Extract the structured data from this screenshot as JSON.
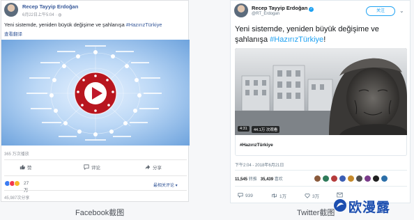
{
  "facebook": {
    "author": "Recep Tayyip Erdoğan",
    "timestamp": "6月22日上午5:04 · ",
    "post_text_prefix": "Yeni sistemde, yeniden büyük değişime ve şahlanışa ",
    "hashtag": "#HazırızTürkiye",
    "translate_label": "查看翻译",
    "views": "365 万次播放",
    "actions": {
      "like": "赞",
      "comment": "评论",
      "share": "分享"
    },
    "reactions_count": "27 万",
    "sort_label": "最相关评论 ▾",
    "shares_count": "45,987次分享",
    "colors": {
      "link": "#365899",
      "play_button": "#c0182b"
    }
  },
  "twitter": {
    "author": "Recep Tayyip Erdoğan",
    "handle": "@RT_Erdogan",
    "follow_label": "关注",
    "tweet_text_prefix": "Yeni sistemde, yeniden büyük değişime ve şahlanışa ",
    "hashtag": "#HazırızTürkiye",
    "tweet_text_suffix": "!",
    "video_duration": "4:31",
    "video_views": "44.1万 次观看",
    "card_hashtag": "#HazırızTürkiye",
    "timestamp": "下午2:04 - 2018年6月21日",
    "retweets_count": "11,545",
    "retweets_label": "转推",
    "likes_count": "35,439",
    "likes_label": "喜欢",
    "reply_count": "939",
    "retweet_action_count": "1万",
    "like_action_count": "3万",
    "colors": {
      "accent": "#1da1f2"
    }
  },
  "captions": {
    "facebook": "Facebook截图",
    "twitter": "Twitter截图"
  },
  "watermark": "欧漫露"
}
